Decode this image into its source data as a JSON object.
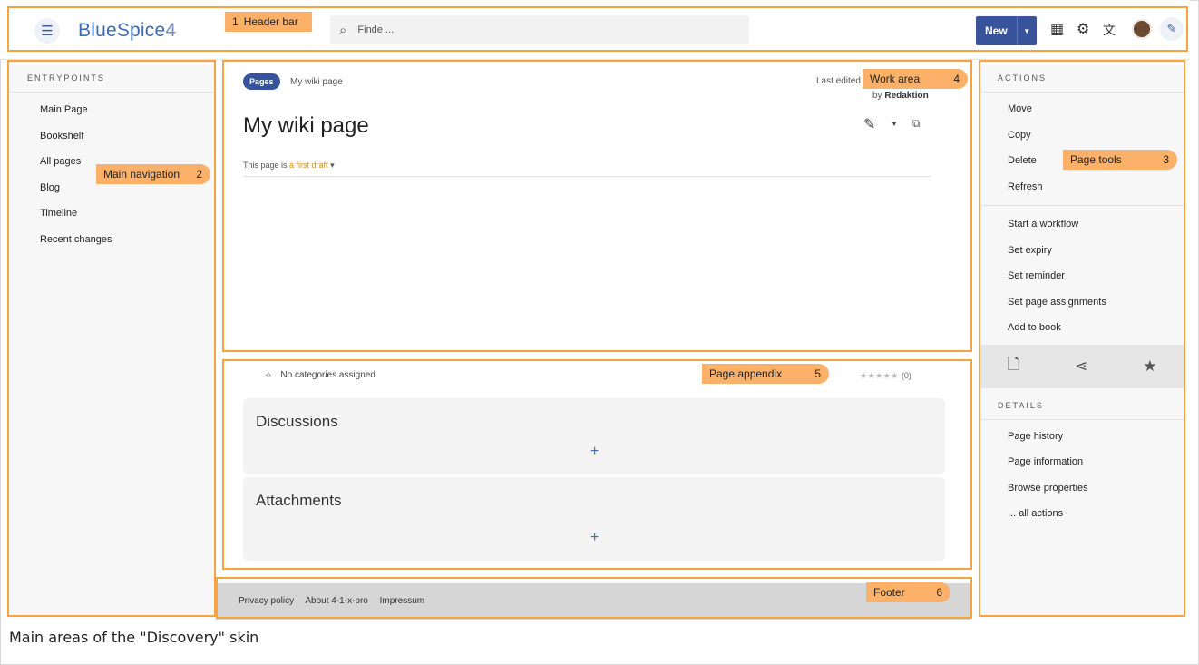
{
  "header": {
    "logo": "BlueSpice",
    "logo_version": "4",
    "search_placeholder": "Finde ...",
    "new_button_label": "New",
    "icons": [
      "menu-icon",
      "search-icon",
      "apps-grid-icon",
      "gear-icon",
      "language-icon",
      "avatar",
      "wrench-icon"
    ]
  },
  "left_nav": {
    "title": "ENTRYPOINTS",
    "items": [
      "Main Page",
      "Bookshelf",
      "All pages",
      "Blog",
      "Timeline",
      "Recent changes"
    ]
  },
  "work_area": {
    "namespace_pill": "Pages",
    "breadcrumb": "My wiki page",
    "last_edited": "Last edited",
    "by_prefix": "by",
    "author": "Redaktion",
    "page_title": "My wiki page",
    "state_prefix": "This page is",
    "state_link": "a first draft"
  },
  "appendix": {
    "categories": "No categories assigned",
    "rating_stars": "★★★★★",
    "rating_count": "(0)",
    "discussions_title": "Discussions",
    "attachments_title": "Attachments",
    "add_glyph": "+"
  },
  "footer": {
    "links": [
      "Privacy policy",
      "About 4-1-x-pro",
      "Impressum"
    ]
  },
  "right_col": {
    "actions_title": "ACTIONS",
    "actions_group1": [
      "Move",
      "Copy",
      "Delete",
      "Refresh"
    ],
    "actions_group2": [
      "Start a workflow",
      "Set expiry",
      "Set reminder",
      "Set page assignments",
      "Add to book"
    ],
    "details_title": "DETAILS",
    "details_items": [
      "Page history",
      "Page information",
      "Browse properties",
      "... all actions"
    ]
  },
  "annotations": [
    {
      "label": "Header bar",
      "number": "1"
    },
    {
      "label": "Main navigation",
      "number": "2"
    },
    {
      "label": "Page tools",
      "number": "3"
    },
    {
      "label": "Work area",
      "number": "4"
    },
    {
      "label": "Page appendix",
      "number": "5"
    },
    {
      "label": "Footer",
      "number": "6"
    }
  ],
  "caption": "Main areas of the \"Discovery\" skin",
  "colors": {
    "brand": "#36539c",
    "annotation_border": "#f7a440",
    "annotation_fill": "#fbb169",
    "draft_link": "#d68d22"
  }
}
